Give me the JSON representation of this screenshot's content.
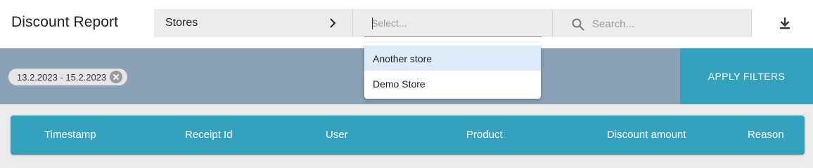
{
  "header": {
    "title": "Discount Report",
    "stores_label": "Stores",
    "select_placeholder": "Select...",
    "search_placeholder": "Search...",
    "download_icon": "download-icon"
  },
  "dropdown": {
    "options": [
      {
        "label": "Another store",
        "highlighted": true
      },
      {
        "label": "Demo Store",
        "highlighted": false
      }
    ],
    "highlight_color": "#deebf9"
  },
  "filters": {
    "date_chip": "13.2.2023 - 15.2.2023",
    "apply_label": "APPLY FILTERS"
  },
  "table": {
    "columns": [
      "Timestamp",
      "Receipt Id",
      "User",
      "Product",
      "Discount amount",
      "Reason"
    ]
  },
  "colors": {
    "accent": "#34a1bf",
    "filter_bar": "#8ba1b5",
    "background": "#ececec"
  }
}
